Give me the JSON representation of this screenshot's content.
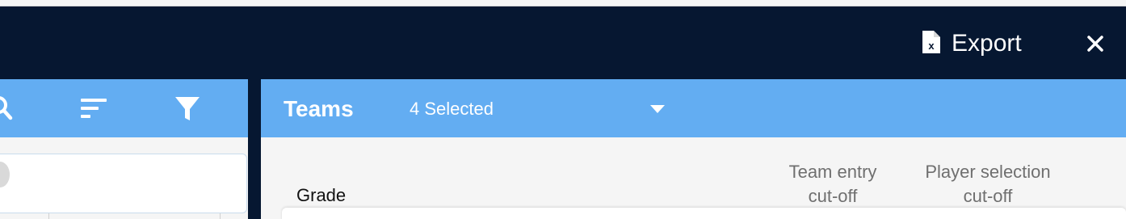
{
  "header": {
    "export_label": "Export",
    "export_icon": "excel-file-icon",
    "close_icon": "close-icon"
  },
  "left_toolbar": {
    "icons": [
      "search-icon",
      "sort-icon",
      "filter-icon"
    ]
  },
  "teams_bar": {
    "title": "Teams",
    "selected_value": "4 Selected"
  },
  "table": {
    "columns": {
      "grade": "Grade",
      "team_entry_line1": "Team entry",
      "team_entry_line2": "cut-off",
      "player_selection_line1": "Player selection",
      "player_selection_line2": "cut-off"
    }
  },
  "colors": {
    "header_bg": "#061731",
    "toolbar_bg": "#63adf2",
    "panel_bg": "#f5f5f5"
  }
}
